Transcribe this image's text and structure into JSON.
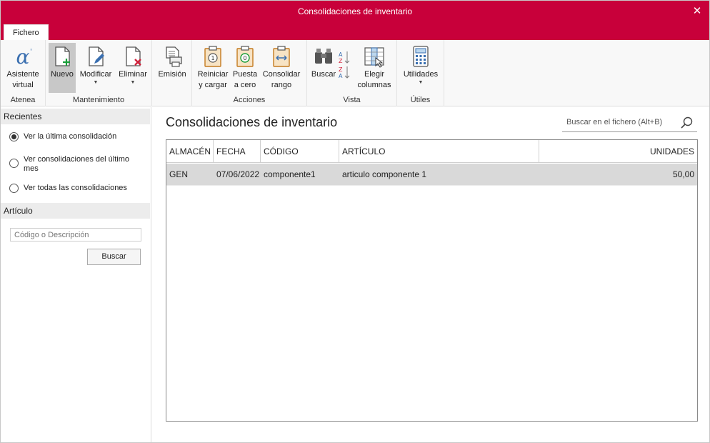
{
  "window": {
    "title": "Consolidaciones de inventario",
    "close_glyph": "✕"
  },
  "tabs": {
    "file": "Fichero"
  },
  "ribbon": {
    "groups": {
      "atenea": "Atenea",
      "mantenimiento": "Mantenimiento",
      "acciones": "Acciones",
      "vista": "Vista",
      "utiles": "Útiles"
    },
    "buttons": {
      "asistente": [
        "Asistente",
        "virtual"
      ],
      "nuevo": "Nuevo",
      "modificar": "Modificar",
      "eliminar": "Eliminar",
      "emision": "Emisión",
      "reiniciar": [
        "Reiniciar",
        "y cargar"
      ],
      "puesta": [
        "Puesta",
        "a cero"
      ],
      "consolidar": [
        "Consolidar",
        "rango"
      ],
      "buscar": "Buscar",
      "elegir": [
        "Elegir",
        "columnas"
      ],
      "utilidades": "Utilidades"
    },
    "caret": "▼"
  },
  "sidebar": {
    "recientes_head": "Recientes",
    "options": [
      {
        "label": "Ver la última consolidación",
        "checked": true
      },
      {
        "label": "Ver consolidaciones del último mes",
        "checked": false
      },
      {
        "label": "Ver todas las consolidaciones",
        "checked": false
      }
    ],
    "articulo_head": "Artículo",
    "articulo_placeholder": "Código o Descripción",
    "buscar_button": "Buscar"
  },
  "main": {
    "title": "Consolidaciones de inventario",
    "search_placeholder": "Buscar en el fichero (Alt+B)",
    "columns": [
      "ALMACÉN",
      "FECHA",
      "CÓDIGO",
      "ARTÍCULO",
      "UNIDADES"
    ],
    "rows": [
      {
        "almacen": "GEN",
        "fecha": "07/06/2022",
        "codigo": "componente1",
        "articulo": "articulo componente 1",
        "unidades": "50,00"
      }
    ]
  },
  "colors": {
    "brand": "#c8003a",
    "accent_orange": "#e8862a",
    "accent_blue": "#3a6fb0"
  }
}
